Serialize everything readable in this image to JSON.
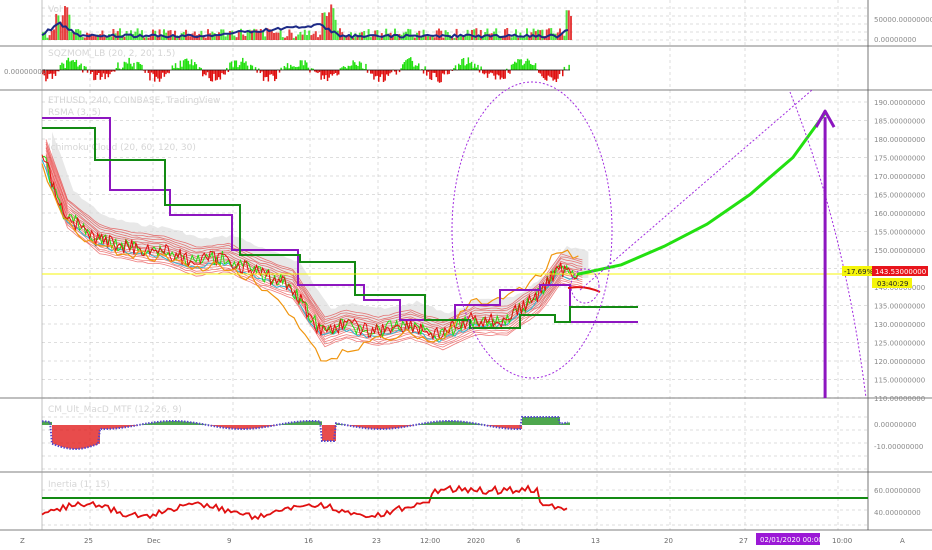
{
  "colors": {
    "red": "#e01010",
    "green": "#23e011",
    "darkgreen": "#138a13",
    "purple": "#8d16c0",
    "orange": "#f0950e",
    "navy": "#1d2a86",
    "yellow": "#f5f50a",
    "dotted": "#a22ce0",
    "cyan": "#2bb9d6",
    "grid": "#bdbdbd"
  },
  "panes": {
    "volume": {
      "label": "Vol",
      "ticks": [
        "50000.00000000",
        "0.00000000"
      ]
    },
    "squeeze": {
      "label": "SQZMOM_LB (20, 2, 20, 1.5)",
      "tick": "0.00000000"
    },
    "main": {
      "label": "ETHUSD, 240, COINBASE, TradingView",
      "sublabel1": "RSMA (3, 5)",
      "sublabel2": "Ichimoku Cloud (20, 60, 120, 30)",
      "ticks": [
        "190.00000000",
        "185.00000000",
        "180.00000000",
        "175.00000000",
        "170.00000000",
        "165.00000000",
        "160.00000000",
        "155.00000000",
        "150.00000000",
        "145.00000000",
        "140.00000000",
        "135.00000000",
        "130.00000000",
        "125.00000000",
        "120.00000000",
        "115.00000000",
        "110.00000000"
      ],
      "price_tag": "143.53000000",
      "pct_tag": "-17.69%",
      "countdown": "03:40:29"
    },
    "macd": {
      "label": "CM_Ult_MacD_MTF (12, 26, 9)",
      "ticks": [
        "0.00000000",
        "-10.00000000"
      ]
    },
    "inertia": {
      "label": "Inertia (1, 15)",
      "ticks": [
        "60.00000000",
        "40.00000000"
      ]
    }
  },
  "x_axis": {
    "ticks": [
      "25",
      "Dec",
      "9",
      "16",
      "23",
      "12:00",
      "2020",
      "6",
      "13",
      "20",
      "27",
      "10:00"
    ],
    "date_tag": "02/01/2020   00:00",
    "corner_left": "Z",
    "corner_right": "A"
  },
  "chart_data": {
    "type": "line",
    "title": "ETHUSD, 240, COINBASE",
    "x_unit": "date (2019-11-20 to 2020-02-05)",
    "y_range": [
      110,
      190
    ],
    "last_price": 143.53,
    "price_series": {
      "name": "ETHUSD close",
      "x": [
        "2019-11-20",
        "2019-11-22",
        "2019-11-25",
        "2019-11-28",
        "2019-12-01",
        "2019-12-04",
        "2019-12-07",
        "2019-12-10",
        "2019-12-13",
        "2019-12-16",
        "2019-12-18",
        "2019-12-21",
        "2019-12-24",
        "2019-12-27",
        "2019-12-30",
        "2020-01-02",
        "2020-01-05",
        "2020-01-07",
        "2020-01-09"
      ],
      "values": [
        176,
        160,
        153,
        151,
        150,
        147,
        148,
        144,
        141,
        128,
        130,
        128,
        130,
        127,
        131,
        131,
        137,
        145,
        143.53
      ]
    },
    "projection": {
      "name": "projected curve",
      "x": [
        "2020-01-09",
        "2020-01-13",
        "2020-01-17",
        "2020-01-21",
        "2020-01-25",
        "2020-01-29",
        "2020-02-01"
      ],
      "values": [
        143.5,
        146,
        151,
        157,
        165,
        175,
        187
      ]
    },
    "target": {
      "date": "2020-02-01",
      "price": 187
    },
    "kijun_levels": [
      {
        "name": "green flat",
        "value": 138,
        "from": "2020-01-04",
        "to": "2020-01-12"
      },
      {
        "name": "purple flat",
        "value": 132,
        "from": "2020-01-04",
        "to": "2020-01-12"
      }
    ]
  }
}
